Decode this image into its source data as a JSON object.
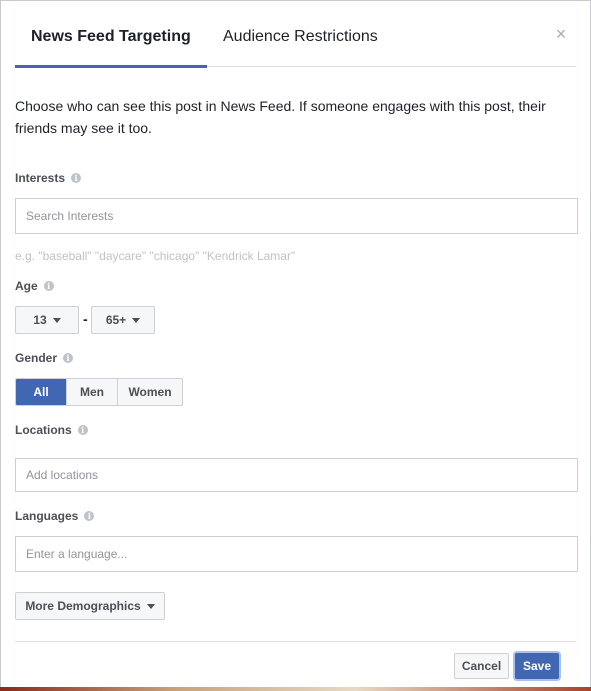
{
  "tabs": [
    {
      "label": "News Feed Targeting",
      "active": true
    },
    {
      "label": "Audience Restrictions",
      "active": false
    }
  ],
  "close_glyph": "×",
  "description": "Choose who can see this post in News Feed. If someone engages with this post, their friends may see it too.",
  "interests": {
    "label": "Interests",
    "placeholder": "Search Interests",
    "hint": "e.g. \"baseball\" \"daycare\" \"chicago\" \"Kendrick Lamar\""
  },
  "age": {
    "label": "Age",
    "min": "13",
    "separator": "-",
    "max": "65+"
  },
  "gender": {
    "label": "Gender",
    "options": [
      "All",
      "Men",
      "Women"
    ],
    "selected": "All"
  },
  "locations": {
    "label": "Locations",
    "placeholder": "Add locations"
  },
  "languages": {
    "label": "Languages",
    "placeholder": "Enter a language..."
  },
  "more_demographics_label": "More Demographics",
  "footer": {
    "cancel_label": "Cancel",
    "save_label": "Save"
  },
  "info_glyph": "i",
  "colors": {
    "accent": "#4267b2",
    "text": "#1d2129",
    "muted": "#90949c"
  }
}
